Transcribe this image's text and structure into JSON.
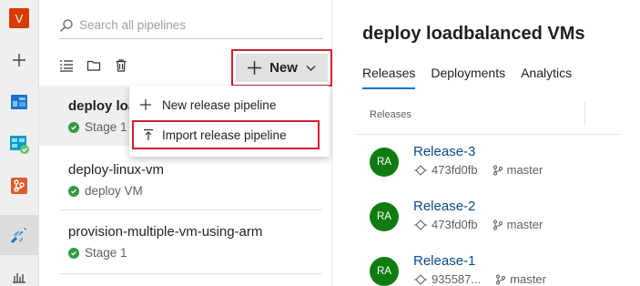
{
  "rail": {
    "project_initial": "V",
    "items": [
      {
        "icon": "project-avatar"
      },
      {
        "icon": "plus-icon"
      },
      {
        "icon": "overview-icon"
      },
      {
        "icon": "boards-icon"
      },
      {
        "icon": "repos-icon"
      },
      {
        "icon": "pipelines-icon"
      },
      {
        "icon": "test-plans-icon"
      }
    ]
  },
  "list": {
    "search_placeholder": "Search all pipelines",
    "new_button": "New",
    "pipelines": [
      {
        "name": "deploy loadbalanced VMs",
        "shown_name": "deploy loa",
        "stage": "Stage 1",
        "selected": true
      },
      {
        "name": "deploy-linux-vm",
        "shown_name": "deploy-linux-vm",
        "stage": "deploy VM",
        "selected": false
      },
      {
        "name": "provision-multiple-vm-using-arm",
        "shown_name": "provision-multiple-vm-using-arm",
        "stage": "Stage 1",
        "selected": false
      }
    ]
  },
  "menu": {
    "items": [
      {
        "label": "New release pipeline",
        "icon": "plus-icon"
      },
      {
        "label": "Import release pipeline",
        "icon": "import-icon",
        "highlighted": true
      }
    ]
  },
  "details": {
    "title": "deploy loadbalanced VMs",
    "tabs": [
      "Releases",
      "Deployments",
      "Analytics"
    ],
    "active_tab": "Releases",
    "column_header": "Releases",
    "releases": [
      {
        "initials": "RA",
        "name": "Release-3",
        "commit": "473fd0fb",
        "branch": "master"
      },
      {
        "initials": "RA",
        "name": "Release-2",
        "commit": "473fd0fb",
        "branch": "master"
      },
      {
        "initials": "RA",
        "name": "Release-1",
        "commit": "935587...",
        "branch": "master"
      }
    ]
  },
  "colors": {
    "accent": "#0078d4",
    "highlight_border": "#d0202f",
    "avatar_green": "#107c10",
    "success": "#339947",
    "project_orange": "#d83b01"
  }
}
